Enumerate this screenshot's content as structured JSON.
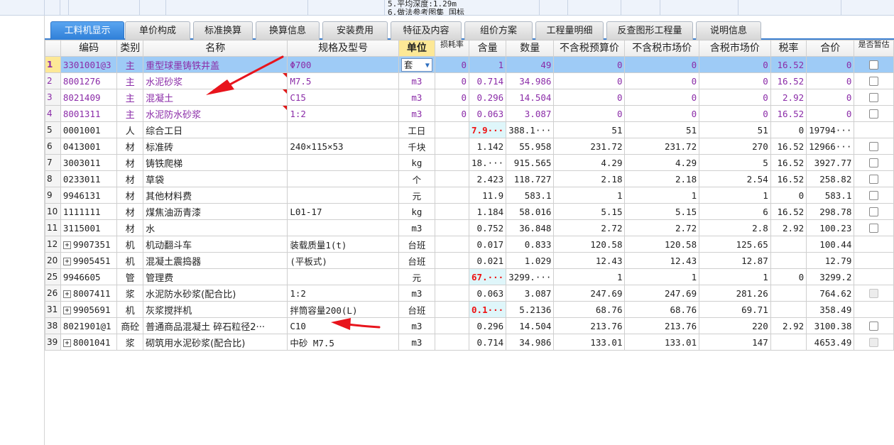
{
  "top_note": [
    "5.平均深度:1.29m",
    "6.做法参考图集 国标"
  ],
  "tabs": [
    {
      "label": "工料机显示",
      "active": true
    },
    {
      "label": "单价构成"
    },
    {
      "label": "标准换算"
    },
    {
      "label": "换算信息"
    },
    {
      "label": "安装费用"
    },
    {
      "label": "特征及内容"
    },
    {
      "label": "组价方案"
    },
    {
      "label": "工程量明细"
    },
    {
      "label": "反查图形工程量"
    },
    {
      "label": "说明信息"
    }
  ],
  "columns": [
    "编码",
    "类别",
    "名称",
    "规格及型号",
    "单位",
    "损耗率",
    "含量",
    "数量",
    "不含税预算价",
    "不含税市场价",
    "含税市场价",
    "税率",
    "合价",
    "是否暂估"
  ],
  "rows": [
    {
      "rn": "1",
      "code": "3301001@3",
      "type": "主",
      "name": "重型球墨铸铁井盖",
      "spec": "Φ700",
      "unit": "套",
      "loss": "0",
      "qty": "1",
      "amount": "49",
      "p1": "0",
      "p2": "0",
      "p3": "0",
      "tax": "16.52",
      "total": "0",
      "chk": "box",
      "main": true,
      "selected": true
    },
    {
      "rn": "2",
      "code": "8001276",
      "type": "主",
      "name": "水泥砂浆",
      "spec": "M7.5",
      "unit": "m3",
      "loss": "0",
      "qty": "0.714",
      "amount": "34.986",
      "p1": "0",
      "p2": "0",
      "p3": "0",
      "tax": "16.52",
      "total": "0",
      "chk": "box",
      "main": true,
      "flag": true
    },
    {
      "rn": "3",
      "code": "8021409",
      "type": "主",
      "name": "混凝土",
      "spec": "C15",
      "unit": "m3",
      "loss": "0",
      "qty": "0.296",
      "amount": "14.504",
      "p1": "0",
      "p2": "0",
      "p3": "0",
      "tax": "2.92",
      "total": "0",
      "chk": "box",
      "main": true,
      "flag": true
    },
    {
      "rn": "4",
      "code": "8001311",
      "type": "主",
      "name": "水泥防水砂浆",
      "spec": "1:2",
      "unit": "m3",
      "loss": "0",
      "qty": "0.063",
      "amount": "3.087",
      "p1": "0",
      "p2": "0",
      "p3": "0",
      "tax": "16.52",
      "total": "0",
      "chk": "box",
      "main": true,
      "flag": true
    },
    {
      "rn": "5",
      "code": "0001001",
      "type": "人",
      "name": "综合工日",
      "spec": "",
      "unit": "工日",
      "loss": "",
      "qty": "7.9···",
      "amount": "388.1···",
      "p1": "51",
      "p2": "51",
      "p3": "51",
      "tax": "0",
      "total": "19794···",
      "chk": "",
      "warn": true
    },
    {
      "rn": "6",
      "code": "0413001",
      "type": "材",
      "name": "标准砖",
      "spec": "240×115×53",
      "unit": "千块",
      "loss": "",
      "qty": "1.142",
      "amount": "55.958",
      "p1": "231.72",
      "p2": "231.72",
      "p3": "270",
      "tax": "16.52",
      "total": "12966···",
      "chk": "box"
    },
    {
      "rn": "7",
      "code": "3003011",
      "type": "材",
      "name": "铸铁爬梯",
      "spec": "",
      "unit": "kg",
      "loss": "",
      "qty": "18.···",
      "amount": "915.565",
      "p1": "4.29",
      "p2": "4.29",
      "p3": "5",
      "tax": "16.52",
      "total": "3927.77",
      "chk": "box"
    },
    {
      "rn": "8",
      "code": "0233011",
      "type": "材",
      "name": "草袋",
      "spec": "",
      "unit": "个",
      "loss": "",
      "qty": "2.423",
      "amount": "118.727",
      "p1": "2.18",
      "p2": "2.18",
      "p3": "2.54",
      "tax": "16.52",
      "total": "258.82",
      "chk": "box"
    },
    {
      "rn": "9",
      "code": "9946131",
      "type": "材",
      "name": "其他材料费",
      "spec": "",
      "unit": "元",
      "loss": "",
      "qty": "11.9",
      "amount": "583.1",
      "p1": "1",
      "p2": "1",
      "p3": "1",
      "tax": "0",
      "total": "583.1",
      "chk": "box"
    },
    {
      "rn": "10",
      "code": "1111111",
      "type": "材",
      "name": "煤焦油沥青漆",
      "spec": "L01-17",
      "unit": "kg",
      "loss": "",
      "qty": "1.184",
      "amount": "58.016",
      "p1": "5.15",
      "p2": "5.15",
      "p3": "6",
      "tax": "16.52",
      "total": "298.78",
      "chk": "box"
    },
    {
      "rn": "11",
      "code": "3115001",
      "type": "材",
      "name": "水",
      "spec": "",
      "unit": "m3",
      "loss": "",
      "qty": "0.752",
      "amount": "36.848",
      "p1": "2.72",
      "p2": "2.72",
      "p3": "2.8",
      "tax": "2.92",
      "total": "100.23",
      "chk": "box"
    },
    {
      "rn": "12",
      "code": "9907351",
      "type": "机",
      "name": "机动翻斗车",
      "spec": "装载质量1(t)",
      "unit": "台班",
      "loss": "",
      "qty": "0.017",
      "amount": "0.833",
      "p1": "120.58",
      "p2": "120.58",
      "p3": "125.65",
      "tax": "",
      "total": "100.44",
      "chk": "",
      "expander": "+"
    },
    {
      "rn": "20",
      "code": "9905451",
      "type": "机",
      "name": "混凝土震捣器",
      "spec": "(平板式)",
      "unit": "台班",
      "loss": "",
      "qty": "0.021",
      "amount": "1.029",
      "p1": "12.43",
      "p2": "12.43",
      "p3": "12.87",
      "tax": "",
      "total": "12.79",
      "chk": "",
      "expander": "+"
    },
    {
      "rn": "25",
      "code": "9946605",
      "type": "管",
      "name": "管理费",
      "spec": "",
      "unit": "元",
      "loss": "",
      "qty": "67.···",
      "amount": "3299.···",
      "p1": "1",
      "p2": "1",
      "p3": "1",
      "tax": "0",
      "total": "3299.2",
      "chk": "",
      "warn": true
    },
    {
      "rn": "26",
      "code": "8007411",
      "type": "浆",
      "name": "水泥防水砂浆(配合比)",
      "spec": "1:2",
      "unit": "m3",
      "loss": "",
      "qty": "0.063",
      "amount": "3.087",
      "p1": "247.69",
      "p2": "247.69",
      "p3": "281.26",
      "tax": "",
      "total": "764.62",
      "chk": "dis",
      "expander": "+"
    },
    {
      "rn": "31",
      "code": "9905691",
      "type": "机",
      "name": "灰浆搅拌机",
      "spec": "拌筒容量200(L)",
      "unit": "台班",
      "loss": "",
      "qty": "0.1···",
      "amount": "5.2136",
      "p1": "68.76",
      "p2": "68.76",
      "p3": "69.71",
      "tax": "",
      "total": "358.49",
      "chk": "",
      "expander": "+",
      "warn": true
    },
    {
      "rn": "38",
      "code": "8021901@1",
      "type": "商砼",
      "name": "普通商品混凝土 碎石粒径2···",
      "spec": "C10",
      "unit": "m3",
      "loss": "",
      "qty": "0.296",
      "amount": "14.504",
      "p1": "213.76",
      "p2": "213.76",
      "p3": "220",
      "tax": "2.92",
      "total": "3100.38",
      "chk": "box"
    },
    {
      "rn": "39",
      "code": "8001041",
      "type": "浆",
      "name": "砌筑用水泥砂浆(配合比)",
      "spec": "中砂 M7.5",
      "unit": "m3",
      "loss": "",
      "qty": "0.714",
      "amount": "34.986",
      "p1": "133.01",
      "p2": "133.01",
      "p3": "147",
      "tax": "",
      "total": "4653.49",
      "chk": "dis",
      "expander": "+"
    }
  ],
  "icons": {
    "dropdown": "chevron-down-icon",
    "expand": "plus-square-icon",
    "annotation": "red-arrow-icon"
  },
  "colors": {
    "accent": "#2f7fd8",
    "main_material": "#8b2ca8",
    "selected_row": "#9ecbf6",
    "warning": "#e11111",
    "annotation_arrow": "#e8141c"
  }
}
